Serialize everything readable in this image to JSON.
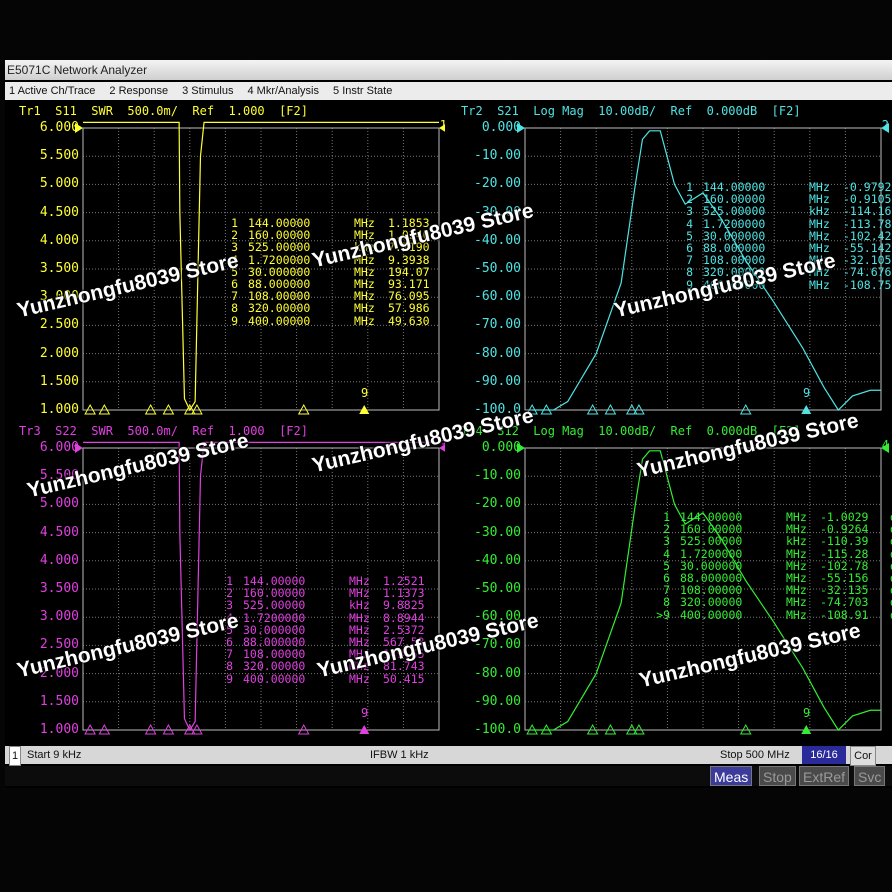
{
  "window": {
    "title": "E5071C Network Analyzer"
  },
  "menu": [
    "1 Active Ch/Trace",
    "2 Response",
    "3 Stimulus",
    "4 Mkr/Analysis",
    "5 Instr State"
  ],
  "colors": {
    "tr1": "#ffff33",
    "tr2": "#4fe3e3",
    "tr3": "#e040e0",
    "tr4": "#33ee33",
    "grid": "#777777"
  },
  "traces": [
    {
      "id": "tr1",
      "title": "Tr1  S11  SWR  500.0m/  Ref  1.000  [F2]",
      "yticks": [
        "6.000",
        "5.500",
        "5.000",
        "4.500",
        "4.000",
        "3.500",
        "3.000",
        "2.500",
        "2.000",
        "1.500",
        "1.000"
      ],
      "ref_marker": "1",
      "active_marker": "9",
      "markers": [
        {
          "n": "1",
          "f": "144.00000",
          "u": "MHz",
          "v": "1.1853",
          "vu": ""
        },
        {
          "n": "2",
          "f": "160.00000",
          "u": "MHz",
          "v": "1.0240",
          "vu": ""
        },
        {
          "n": "3",
          "f": "525.00000",
          "u": "kHz",
          "v": "7.1190",
          "vu": "k"
        },
        {
          "n": "4",
          "f": "1.7200000",
          "u": "MHz",
          "v": "9.3938",
          "vu": "k"
        },
        {
          "n": "5",
          "f": "30.000000",
          "u": "MHz",
          "v": "194.07",
          "vu": ""
        },
        {
          "n": "6",
          "f": "88.000000",
          "u": "MHz",
          "v": "93.171",
          "vu": ""
        },
        {
          "n": "7",
          "f": "108.00000",
          "u": "MHz",
          "v": "76.095",
          "vu": ""
        },
        {
          "n": "8",
          "f": "320.00000",
          "u": "MHz",
          "v": "57.986",
          "vu": ""
        },
        {
          "n": "9",
          "f": "400.00000",
          "u": "MHz",
          "v": "49.630",
          "vu": ""
        }
      ]
    },
    {
      "id": "tr2",
      "title": "Tr2  S21  Log Mag  10.00dB/  Ref  0.000dB  [F2]",
      "yticks": [
        "0.000",
        "-10.00",
        "-20.00",
        "-30.00",
        "-40.00",
        "-50.00",
        "-60.00",
        "-70.00",
        "-80.00",
        "-90.00",
        "-100.0"
      ],
      "ref_marker": "2",
      "active_marker": "9",
      "markers": [
        {
          "n": "1",
          "f": "144.00000",
          "u": "MHz",
          "v": "-0.9792",
          "vu": ""
        },
        {
          "n": "2",
          "f": "160.00000",
          "u": "MHz",
          "v": "-0.9105",
          "vu": ""
        },
        {
          "n": "3",
          "f": "525.00000",
          "u": "kHz",
          "v": "-114.16",
          "vu": ""
        },
        {
          "n": "4",
          "f": "1.7200000",
          "u": "MHz",
          "v": "-113.78",
          "vu": ""
        },
        {
          "n": "5",
          "f": "30.000000",
          "u": "MHz",
          "v": "-102.42",
          "vu": ""
        },
        {
          "n": "6",
          "f": "88.000000",
          "u": "MHz",
          "v": "-55.142",
          "vu": ""
        },
        {
          "n": "7",
          "f": "108.00000",
          "u": "MHz",
          "v": "-32.105",
          "vu": ""
        },
        {
          "n": "8",
          "f": "320.00000",
          "u": "MHz",
          "v": "-74.676",
          "vu": ""
        },
        {
          "n": "9",
          "f": "400.00000",
          "u": "MHz",
          "v": "-108.75",
          "vu": ""
        }
      ]
    },
    {
      "id": "tr3",
      "title": "Tr3  S22  SWR  500.0m/  Ref  1.000  [F2]",
      "yticks": [
        "6.000",
        "5.500",
        "5.000",
        "4.500",
        "4.000",
        "3.500",
        "3.000",
        "2.500",
        "2.000",
        "1.500",
        "1.000"
      ],
      "ref_marker": "3",
      "active_marker": "9",
      "markers": [
        {
          "n": "1",
          "f": "144.00000",
          "u": "MHz",
          "v": "1.2521",
          "vu": ""
        },
        {
          "n": "2",
          "f": "160.00000",
          "u": "MHz",
          "v": "1.1373",
          "vu": ""
        },
        {
          "n": "3",
          "f": "525.00000",
          "u": "kHz",
          "v": "9.8825",
          "vu": "k"
        },
        {
          "n": "4",
          "f": "1.7200000",
          "u": "MHz",
          "v": "8.8944",
          "vu": "k"
        },
        {
          "n": "5",
          "f": "30.000000",
          "u": "MHz",
          "v": "2.5372",
          "vu": "k"
        },
        {
          "n": "6",
          "f": "88.000000",
          "u": "MHz",
          "v": "567.53",
          "vu": ""
        },
        {
          "n": "7",
          "f": "108.00000",
          "u": "MHz",
          "v": "149.55",
          "vu": ""
        },
        {
          "n": "8",
          "f": "320.00000",
          "u": "MHz",
          "v": "81.743",
          "vu": ""
        },
        {
          "n": "9",
          "f": "400.00000",
          "u": "MHz",
          "v": "50.415",
          "vu": ""
        }
      ]
    },
    {
      "id": "tr4",
      "title": "Tr4  S12  Log Mag  10.00dB/  Ref  0.000dB  [F2]",
      "yticks": [
        "0.000",
        "-10.00",
        "-20.00",
        "-30.00",
        "-40.00",
        "-50.00",
        "-60.00",
        "-70.00",
        "-80.00",
        "-90.00",
        "-100.0"
      ],
      "ref_marker": "4",
      "active_marker": "9",
      "markers": [
        {
          "n": "1",
          "f": "144.00000",
          "u": "MHz",
          "v": "-1.0029",
          "vu": "dB"
        },
        {
          "n": "2",
          "f": "160.00000",
          "u": "MHz",
          "v": "-0.9264",
          "vu": "dB"
        },
        {
          "n": "3",
          "f": "525.00000",
          "u": "kHz",
          "v": "-110.39",
          "vu": "dB"
        },
        {
          "n": "4",
          "f": "1.7200000",
          "u": "MHz",
          "v": "-115.28",
          "vu": "dB"
        },
        {
          "n": "5",
          "f": "30.000000",
          "u": "MHz",
          "v": "-102.78",
          "vu": "dB"
        },
        {
          "n": "6",
          "f": "88.000000",
          "u": "MHz",
          "v": "-55.156",
          "vu": "dB"
        },
        {
          "n": "7",
          "f": "108.00000",
          "u": "MHz",
          "v": "-32.135",
          "vu": "dB"
        },
        {
          "n": "8",
          "f": "320.00000",
          "u": "MHz",
          "v": "-74.703",
          "vu": "dB"
        },
        {
          "n": ">9",
          "f": "400.00000",
          "u": "MHz",
          "v": "-108.91",
          "vu": "dB"
        }
      ]
    }
  ],
  "status": {
    "channel": "1",
    "start": "Start 9 kHz",
    "ifbw": "IFBW 1 kHz",
    "stop": "Stop 500 MHz",
    "avg": "16/16",
    "cor": "Cor"
  },
  "softkeys": [
    "Meas",
    "Stop",
    "ExtRef",
    "Svc"
  ],
  "watermark": "Yunzhongfu8039 Store"
}
